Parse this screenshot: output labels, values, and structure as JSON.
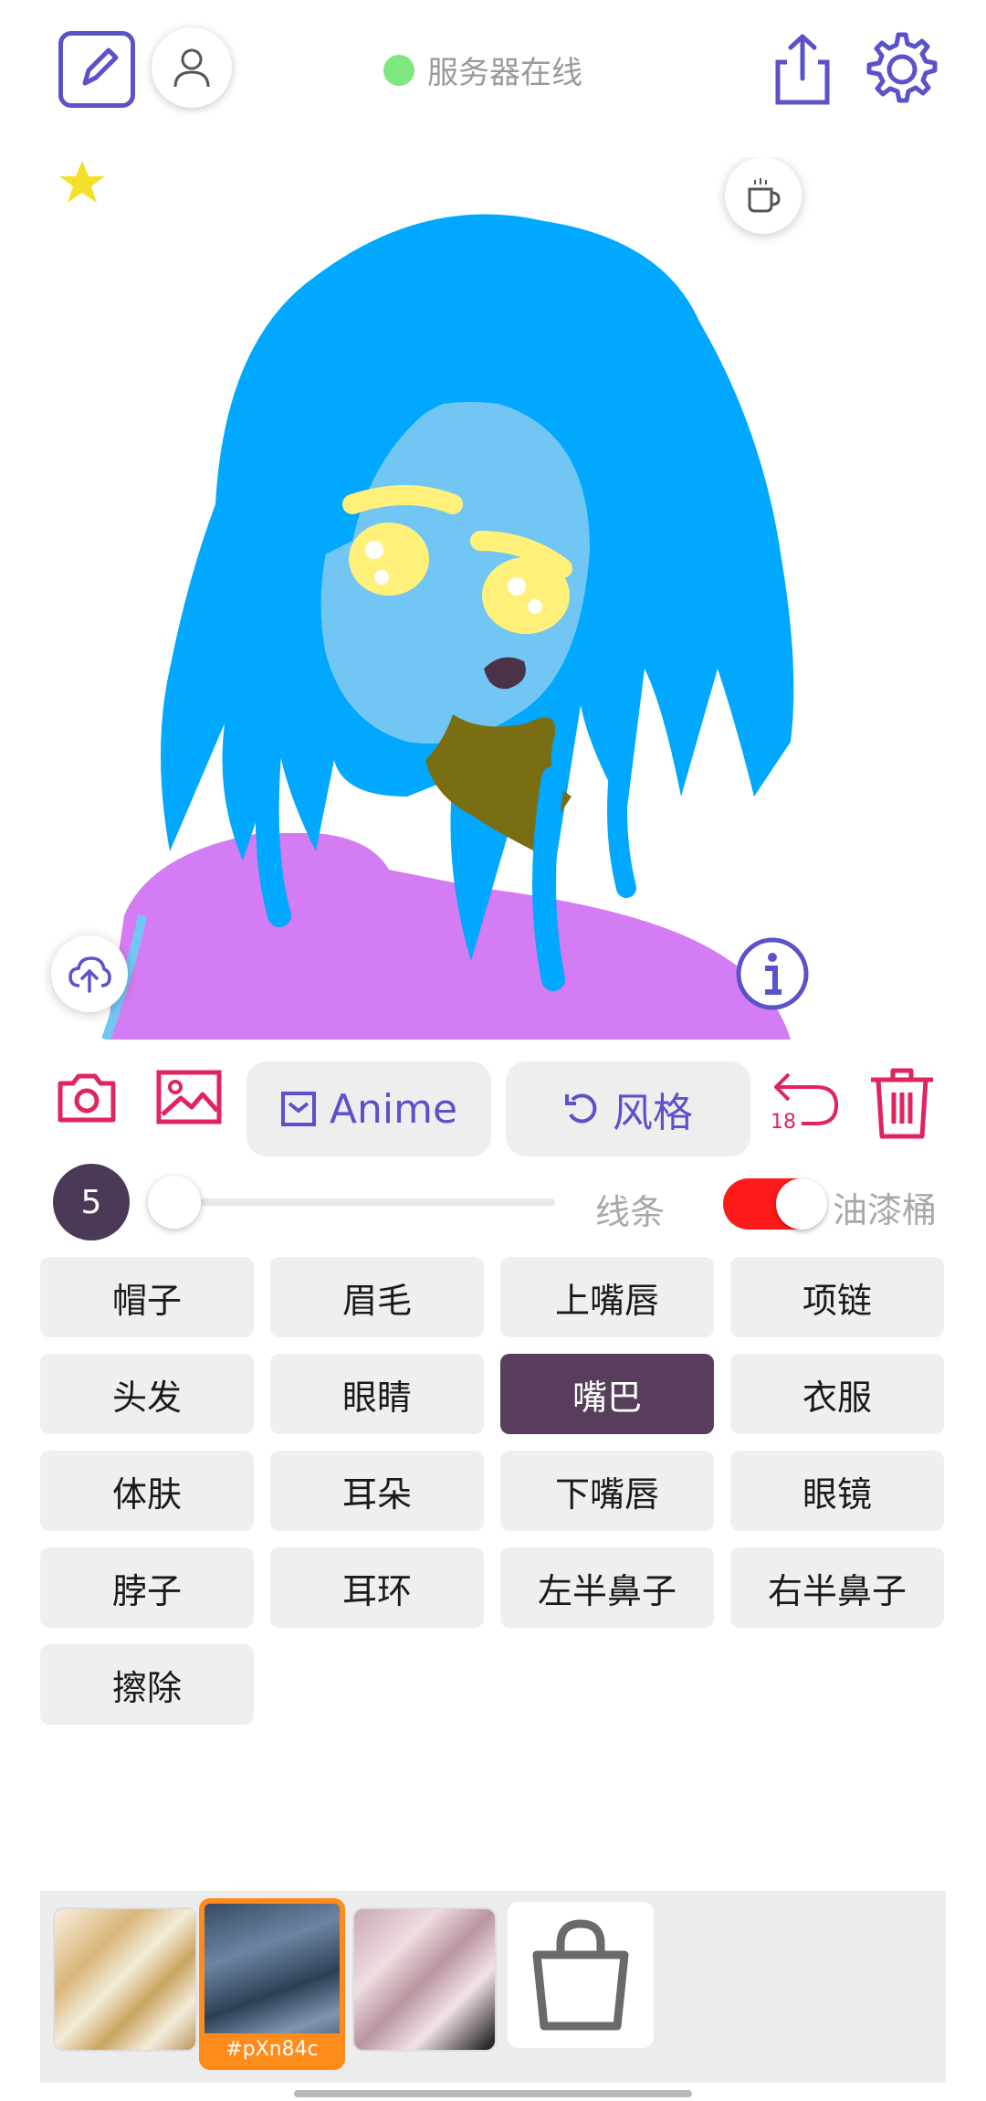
{
  "header": {
    "status_text": "服务器在线",
    "status_color": "#7ee87e",
    "icons": [
      "edit-note-icon",
      "user-icon",
      "share-icon",
      "settings-gear-icon"
    ]
  },
  "canvas": {
    "corner_icons": [
      "star-icon",
      "coffee-cup-icon",
      "cloud-upload-icon",
      "info-icon"
    ],
    "colors": {
      "hair": "#00a8ff",
      "skin": "#72c6f4",
      "eyes": "#fff07a",
      "mouth": "#4a3248",
      "neck": "#7a6e12",
      "shirt": "#d47cf4"
    }
  },
  "toolbar": {
    "anime_label": "Anime",
    "style_label": "风格",
    "undo_count": "18",
    "accent_color": "#5b52c9",
    "icon_color": "#e0245e"
  },
  "brush": {
    "size": "5",
    "size_fraction": 0.0,
    "line_label": "线条",
    "bucket_label": "油漆桶",
    "bucket_enabled": true
  },
  "parts": [
    {
      "label": "帽子",
      "active": false
    },
    {
      "label": "眉毛",
      "active": false
    },
    {
      "label": "上嘴唇",
      "active": false
    },
    {
      "label": "项链",
      "active": false
    },
    {
      "label": "头发",
      "active": false
    },
    {
      "label": "眼睛",
      "active": false
    },
    {
      "label": "嘴巴",
      "active": true
    },
    {
      "label": "衣服",
      "active": false
    },
    {
      "label": "体肤",
      "active": false
    },
    {
      "label": "耳朵",
      "active": false
    },
    {
      "label": "下嘴唇",
      "active": false
    },
    {
      "label": "眼镜",
      "active": false
    },
    {
      "label": "脖子",
      "active": false
    },
    {
      "label": "耳环",
      "active": false
    },
    {
      "label": "左半鼻子",
      "active": false
    },
    {
      "label": "右半鼻子",
      "active": false
    },
    {
      "label": "擦除",
      "active": false
    }
  ],
  "palette": {
    "selected_label": "#pXn84c",
    "selected_color": "#ff8c1a"
  }
}
